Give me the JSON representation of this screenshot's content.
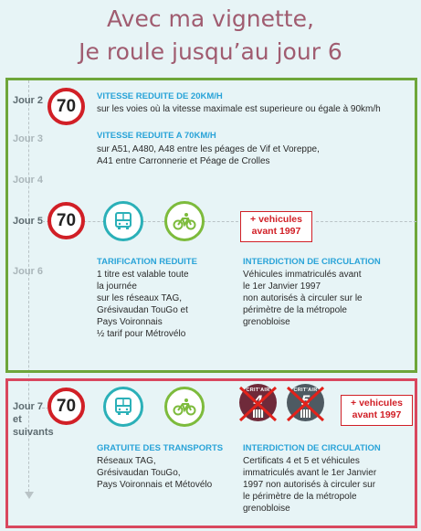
{
  "title": {
    "line1": "Avec ma vignette,",
    "line2": "Je roule jusqu’au jour 6"
  },
  "days": {
    "d2": "Jour 2",
    "d3": "Jour 3",
    "d4": "Jour 4",
    "d5": "Jour 5",
    "d6": "Jour 6",
    "d7a": "Jour 7",
    "d7b": "et",
    "d7c": "suivants"
  },
  "speed_sign_value": "70",
  "section1": {
    "h1": "VITESSE REDUITE DE 20KM/H",
    "t1": "sur les voies où la vitesse maximale est superieure ou égale à 90km/h",
    "h2": "VITESSE REDUITE A 70KM/H",
    "t2": "sur A51, A480, A48 entre les péages de Vif et Voreppe,\nA41 entre Carronnerie et Péage de Crolles",
    "red_label": "+ vehicules\navant 1997",
    "h3": "TARIFICATION REDUITE",
    "t3": "1 titre est valable toute\nla journée\nsur les réseaux TAG,\nGrésivaudan TouGo et\nPays Voironnais\n½ tarif pour Métrovélo",
    "h4": "INTERDICTION DE CIRCULATION",
    "t4": "Véhicules immatriculés avant\nle 1er Janvier 1997\nnon autorisés à circuler sur le\npérimètre de la métropole\ngrenobloise"
  },
  "section2": {
    "vignette_label": "CRIT'AIR",
    "vignette_4": "4",
    "vignette_5": "5",
    "red_label": "+ vehicules\navant 1997",
    "h1": "GRATUITE DES TRANSPORTS",
    "t1": "Réseaux TAG,\nGrésivaudan TouGo,\nPays Voironnais et Métovélo",
    "h2": "INTERDICTION DE CIRCULATION",
    "t2": "Certificats 4 et 5  et véhicules\nimmatriculés avant le 1er Janvier\n1997 non autorisés à circuler sur\nle périmètre de la métropole\ngrenobloise"
  },
  "colors": {
    "green_frame": "#6ea63a",
    "red_frame": "#d9475e",
    "speed_ring": "#d11f26",
    "bus_teal": "#2bb0b8",
    "bike_green": "#7dbb3c",
    "heading_blue": "#29a3d8",
    "title_mauve": "#a05c70",
    "vignette4": "#6f2a3a",
    "vignette5": "#4e5a62"
  }
}
